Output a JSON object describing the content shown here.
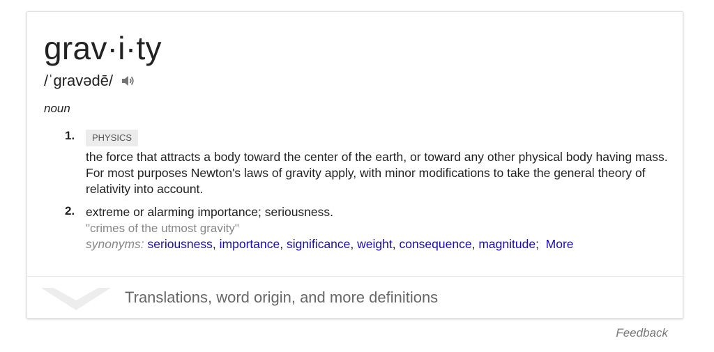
{
  "entry": {
    "headword": "grav·i·ty",
    "pronunciation": "/ˈɡravədē/",
    "speaker_icon": "speaker-icon",
    "part_of_speech": "noun"
  },
  "senses": [
    {
      "number": "1.",
      "domain_label": "PHYSICS",
      "definition": "the force that attracts a body toward the center of the earth, or toward any other physical body having mass. For most purposes Newton's laws of gravity apply, with minor modifications to take the general theory of relativity into account."
    },
    {
      "number": "2.",
      "definition": "extreme or alarming importance; seriousness.",
      "example": "\"crimes of the utmost gravity\"",
      "synonyms_label": "synonyms:",
      "synonyms": [
        "seriousness",
        "importance",
        "significance",
        "weight",
        "consequence",
        "magnitude"
      ],
      "more_label": "More"
    }
  ],
  "footer": {
    "expand_text": "Translations, word origin, and more definitions",
    "chevron_icon": "chevron-down-icon"
  },
  "feedback_label": "Feedback",
  "colors": {
    "link": "#1a0dab",
    "muted": "#878787",
    "label_bg": "#ececec"
  }
}
